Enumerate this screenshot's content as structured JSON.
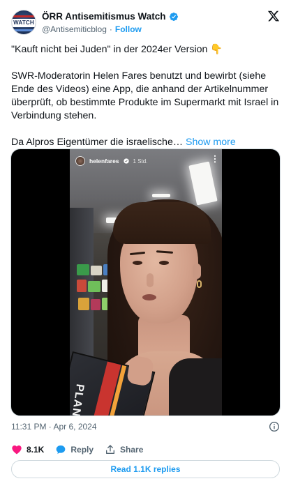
{
  "header": {
    "display_name": "ÖRR Antisemitismus Watch",
    "handle": "@Antisemiticblog",
    "separator": "·",
    "follow_label": "Follow",
    "avatar_text": "WATCH",
    "verified_color": "#1d9bf0",
    "icons": [
      "verified-badge-icon",
      "x-logo-icon"
    ]
  },
  "tweet": {
    "paragraphs": [
      "\"Kauft nicht bei Juden\" in der 2024er Version 👇",
      "SWR-Moderatorin Helen Fares benutzt und bewirbt (siehe Ende des Videos) eine App, die anhand der Artikelnummer überprüft, ob bestimmte Produkte im Supermarkt mit Israel in Verbindung stehen."
    ],
    "last_paragraph": "Da Alpros Eigentümer die israelische…",
    "show_more_label": "Show more"
  },
  "media": {
    "story_user": "helenfares",
    "story_time": "1 Std.",
    "product_text": "PLANT PROTEIN"
  },
  "footer": {
    "timestamp": "11:31 PM · Apr 6, 2024",
    "like_count": "8.1K",
    "reply_label": "Reply",
    "share_label": "Share",
    "read_replies_label": "Read 1.1K replies",
    "like_color": "#f91880",
    "accent_color": "#1d9bf0",
    "icons": [
      "heart-icon",
      "reply-bubble-icon",
      "share-icon",
      "info-icon"
    ]
  }
}
